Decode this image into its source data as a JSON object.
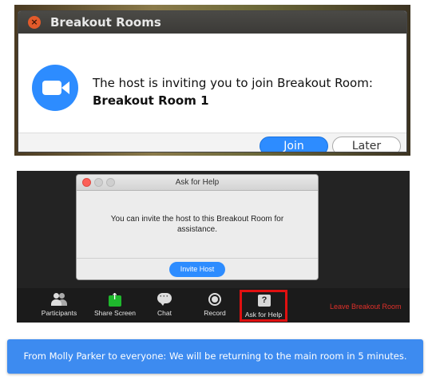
{
  "breakout_invite": {
    "title": "Breakout Rooms",
    "message": "The host is inviting you to join Breakout Room:",
    "room_name": "Breakout Room 1",
    "join_label": "Join",
    "later_label": "Later",
    "icons": {
      "close": "close-icon",
      "app": "zoom-camera-icon"
    },
    "colors": {
      "accent": "#2d8cff",
      "close": "#e25a2a"
    }
  },
  "ask_for_help": {
    "title": "Ask for Help",
    "message": "You can invite the host to this Breakout Room for assistance.",
    "invite_label": "Invite Host",
    "colors": {
      "accent": "#2d8cff"
    }
  },
  "toolbar": {
    "items": [
      {
        "label": "Participants",
        "icon": "participants-icon"
      },
      {
        "label": "Share Screen",
        "icon": "share-screen-icon"
      },
      {
        "label": "Chat",
        "icon": "chat-icon"
      },
      {
        "label": "Record",
        "icon": "record-icon"
      },
      {
        "label": "Ask for Help",
        "icon": "help-icon"
      }
    ],
    "leave_label": "Leave Breakout Room",
    "colors": {
      "highlight": "#e01010",
      "leave": "#e0302a"
    }
  },
  "chat_banner": {
    "text": "From Molly Parker to everyone: We will be returning to the main room in 5 minutes.",
    "colors": {
      "background": "#3d8bf0"
    }
  }
}
